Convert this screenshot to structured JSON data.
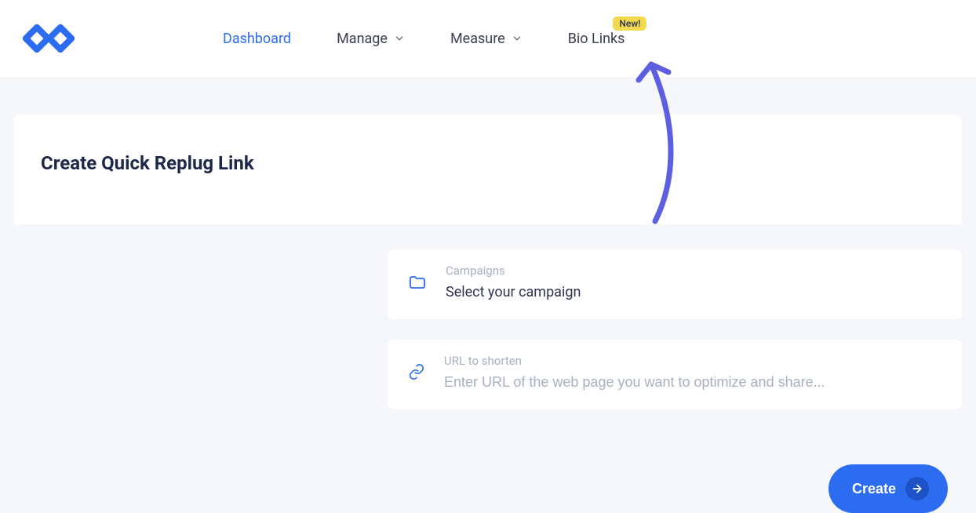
{
  "nav": {
    "dashboard": "Dashboard",
    "manage": "Manage",
    "measure": "Measure",
    "biolinks": "Bio Links",
    "badge_new": "New!"
  },
  "page": {
    "title": "Create Quick Replug Link"
  },
  "fields": {
    "campaign_label": "Campaigns",
    "campaign_value": "Select your campaign",
    "url_label": "URL to shorten",
    "url_placeholder": "Enter URL of the web page you want to optimize and share..."
  },
  "buttons": {
    "create": "Create"
  },
  "colors": {
    "accent": "#2C6CF0",
    "annotation": "#5B5FE0",
    "badge_bg": "#F2D94E"
  }
}
